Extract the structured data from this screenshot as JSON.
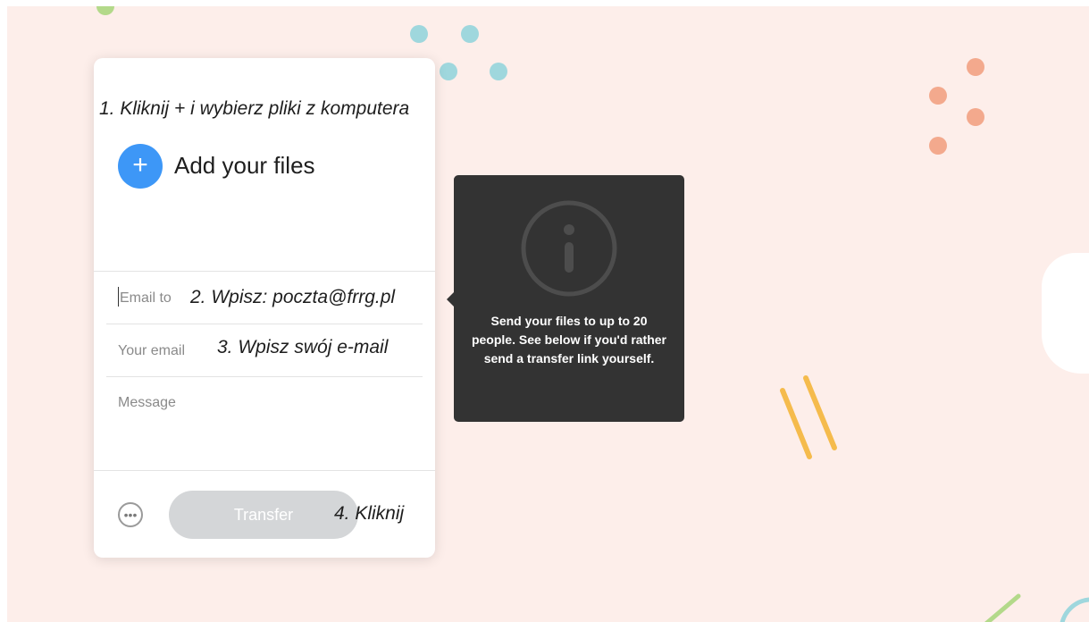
{
  "panel": {
    "step1_note": "1. Kliknij + i wybierz pliki z komputera",
    "add_icon": "plus-icon",
    "add_label": "Add your files",
    "email_to_placeholder": "Email to",
    "step2_note": "2. Wpisz: poczta@frrg.pl",
    "your_email_placeholder": "Your email",
    "step3_note": "3. Wpisz swój e-mail",
    "message_placeholder": "Message",
    "more_icon": "more-options-icon",
    "transfer_label": "Transfer",
    "step4_note": "4. Kliknij"
  },
  "tooltip": {
    "icon": "info-icon",
    "text": "Send your files to up to 20 people. See below if you'd rather send a transfer link yourself."
  },
  "colors": {
    "background": "#fdeeea",
    "accent": "#3d97f7",
    "tooltip_bg": "#333333",
    "button_disabled": "#d4d6d8"
  }
}
